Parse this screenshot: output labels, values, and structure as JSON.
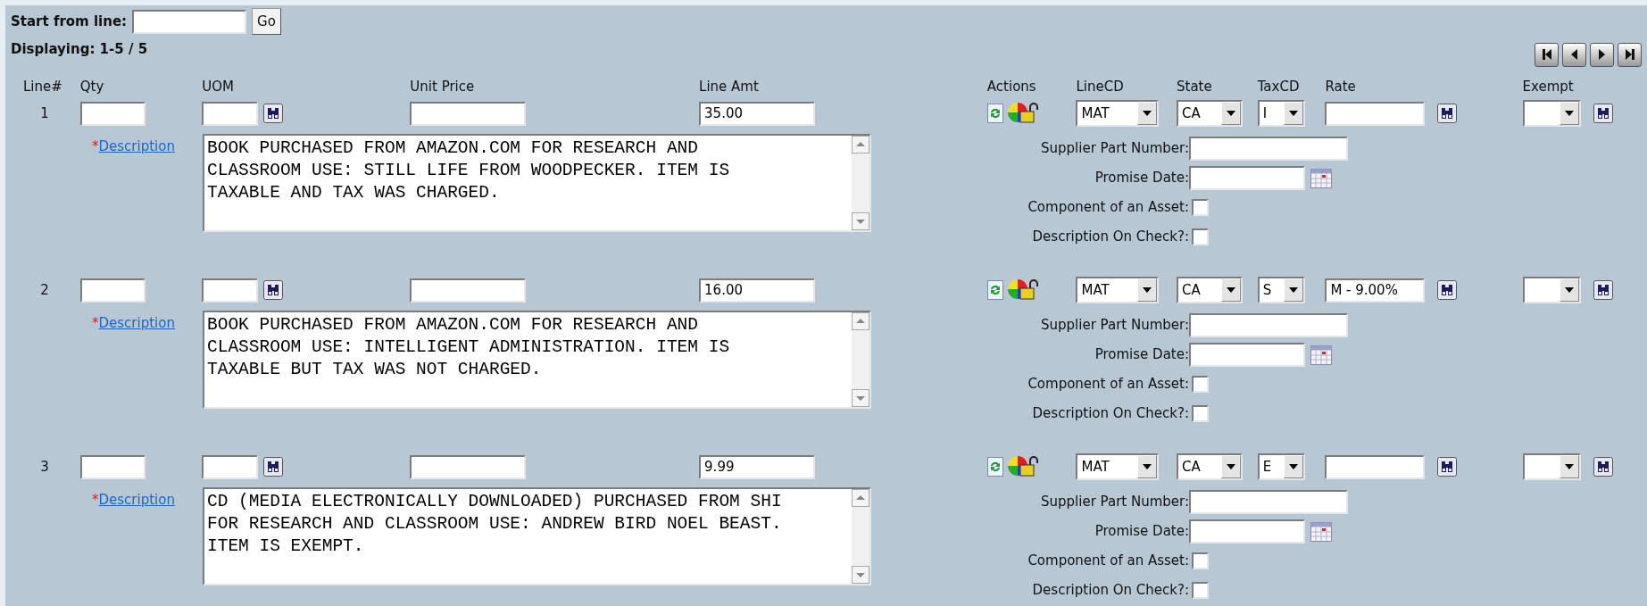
{
  "start_from": {
    "label": "Start from line:",
    "button": "Go"
  },
  "displaying": "Displaying: 1-5 / 5",
  "pager": [
    {
      "kind": "first"
    },
    {
      "kind": "previous"
    },
    {
      "kind": "next"
    },
    {
      "kind": "last"
    }
  ],
  "columns": [
    "Line#",
    "Qty",
    "UOM",
    "Unit Price",
    "Line Amt",
    "Actions",
    "LineCD",
    "State",
    "TaxCD",
    "Rate",
    "Exempt"
  ],
  "lines": [
    {
      "number": "1",
      "line_amt": "35.00",
      "line_cd": "MAT",
      "state": "CA",
      "tax_cd": "I",
      "description_link": {
        "mark": "*",
        "label": "Description"
      },
      "description_lines": [
        "BOOK PURCHASED FROM AMAZON.COM FOR RESEARCH AND",
        "CLASSROOM USE: STILL LIFE FROM WOODPECKER. ITEM IS",
        "TAXABLE AND TAX WAS CHARGED."
      ],
      "extra_fields": [
        {
          "kind": "text",
          "label": "Supplier Part Number:"
        },
        {
          "kind": "date",
          "label": "Promise Date:"
        },
        {
          "kind": "checkbox",
          "label": "Component of an Asset:",
          "checked": false
        },
        {
          "kind": "checkbox",
          "label": "Description On Check?:",
          "checked": false
        }
      ]
    },
    {
      "number": "2",
      "line_amt": "16.00",
      "line_cd": "MAT",
      "state": "CA",
      "tax_cd": "S",
      "rate": "M - 9.00%",
      "description_link": {
        "mark": "*",
        "label": "Description"
      },
      "description_lines": [
        "BOOK PURCHASED FROM AMAZON.COM FOR RESEARCH AND",
        "CLASSROOM USE: INTELLIGENT ADMINISTRATION. ITEM IS",
        "TAXABLE BUT TAX WAS NOT CHARGED."
      ],
      "extra_fields": [
        {
          "kind": "text",
          "label": "Supplier Part Number:"
        },
        {
          "kind": "date",
          "label": "Promise Date:"
        },
        {
          "kind": "checkbox",
          "label": "Component of an Asset:",
          "checked": false
        },
        {
          "kind": "checkbox",
          "label": "Description On Check?:",
          "checked": false
        }
      ]
    },
    {
      "number": "3",
      "line_amt": "9.99",
      "line_cd": "MAT",
      "state": "CA",
      "tax_cd": "E",
      "description_link": {
        "mark": "*",
        "label": "Description"
      },
      "description_lines": [
        "CD (MEDIA ELECTRONICALLY DOWNLOADED) PURCHASED FROM SHI",
        "FOR RESEARCH AND CLASSROOM USE: ANDREW BIRD NOEL BEAST.",
        "ITEM IS EXEMPT."
      ],
      "extra_fields": [
        {
          "kind": "text",
          "label": "Supplier Part Number:"
        },
        {
          "kind": "date",
          "label": "Promise Date:"
        },
        {
          "kind": "checkbox",
          "label": "Component of an Asset:",
          "checked": false
        },
        {
          "kind": "checkbox",
          "label": "Description On Check?:",
          "checked": false
        }
      ]
    }
  ]
}
